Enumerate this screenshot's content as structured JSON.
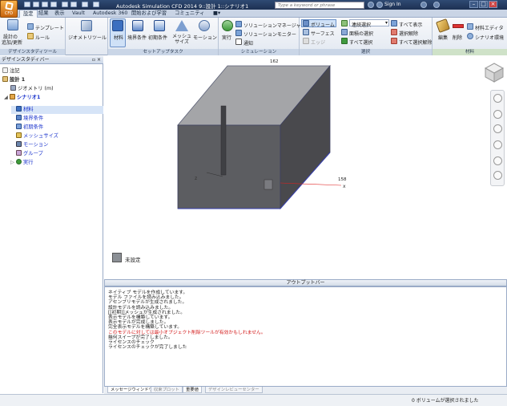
{
  "app": {
    "title": "Autodesk Simulation CFD 2014  9::設計 1::シナリオ1",
    "menu_label": "CFD",
    "search_placeholder": "Type a keyword or phrase",
    "sign_in": "Sign In"
  },
  "tabs": [
    "設定",
    "結果",
    "表示",
    "Vault",
    "Autodesk 360",
    "開始および学習",
    "コミュニティ"
  ],
  "ribbon": {
    "setup_tools": {
      "label": "デザインスタディツール",
      "new_design": "設計の",
      "new_design2": "追加/更新",
      "template": "テンプレート",
      "rule": "ルール"
    },
    "geometry": {
      "label": "ジオメトリツール"
    },
    "setup_tasks": {
      "label": "セットアップタスク",
      "items": [
        "材料",
        "境界条件",
        "初期条件",
        "メッシュサイズ",
        "モーション"
      ]
    },
    "simulation": {
      "label": "シミュレーション",
      "run": "実行",
      "solution_manager": "ソリューションマネージャー",
      "solution_monitor": "ソリューションモニター",
      "notify": "通知"
    },
    "selection": {
      "label": "選択",
      "volume": "ボリューム",
      "surface": "サーフェス",
      "edge": "エッジ",
      "connected": "連続選択",
      "select_by_area": "面積の選択",
      "select_all": "すべて選択",
      "show_all": "すべて表示",
      "deselect": "選択解除",
      "deselect_all": "すべて選択解除"
    },
    "materials": {
      "label": "材料",
      "edit": "編集",
      "delete": "削除",
      "material_editor": "材料エディタ",
      "scenario_env": "シナリオ環境"
    }
  },
  "left_panel": {
    "title": "デザインスタディバー",
    "tree": [
      "注記",
      "設計 1",
      "ジオメトリ (m)",
      "シナリオ1",
      "材料",
      "境界条件",
      "初期条件",
      "メッシュサイズ",
      "モーション",
      "グループ",
      "実行"
    ]
  },
  "viewport": {
    "legend": "未設定",
    "axis_x": "x",
    "axis_z": "z",
    "dim_top": "162",
    "dim_right": "158"
  },
  "output": {
    "title": "アウトプットバー",
    "lines": [
      "ネイティブ モデルを作成しています。",
      "モデル ファイルを読み込みました。",
      "アセンブリモデルが生成されました。",
      "設計モデルを読み込みました。",
      "[[初期]]メッシュが生成されました。",
      "表示モデルを構築しています。",
      "表示モデルが完成しました。",
      "完全表示モデルを構築しています。",
      "このモデルに対しては最小オブジェクト削除ツールが有効かもしれません。",
      "幾何スイープが完了しました。",
      "ライセンスのチェック",
      "ライセンスのチェックが完了しました"
    ],
    "tabs": [
      "メッセージウィンドウ",
      "収束プロット",
      "重要値",
      "デザインレビューセンター"
    ]
  },
  "status": {
    "text": "0 ボリュームが選択されました"
  },
  "colors": {
    "titlebar": "#1d3153",
    "box_face": "#58585c",
    "tree_blue": "#1a33cc",
    "warn": "#d21414"
  }
}
